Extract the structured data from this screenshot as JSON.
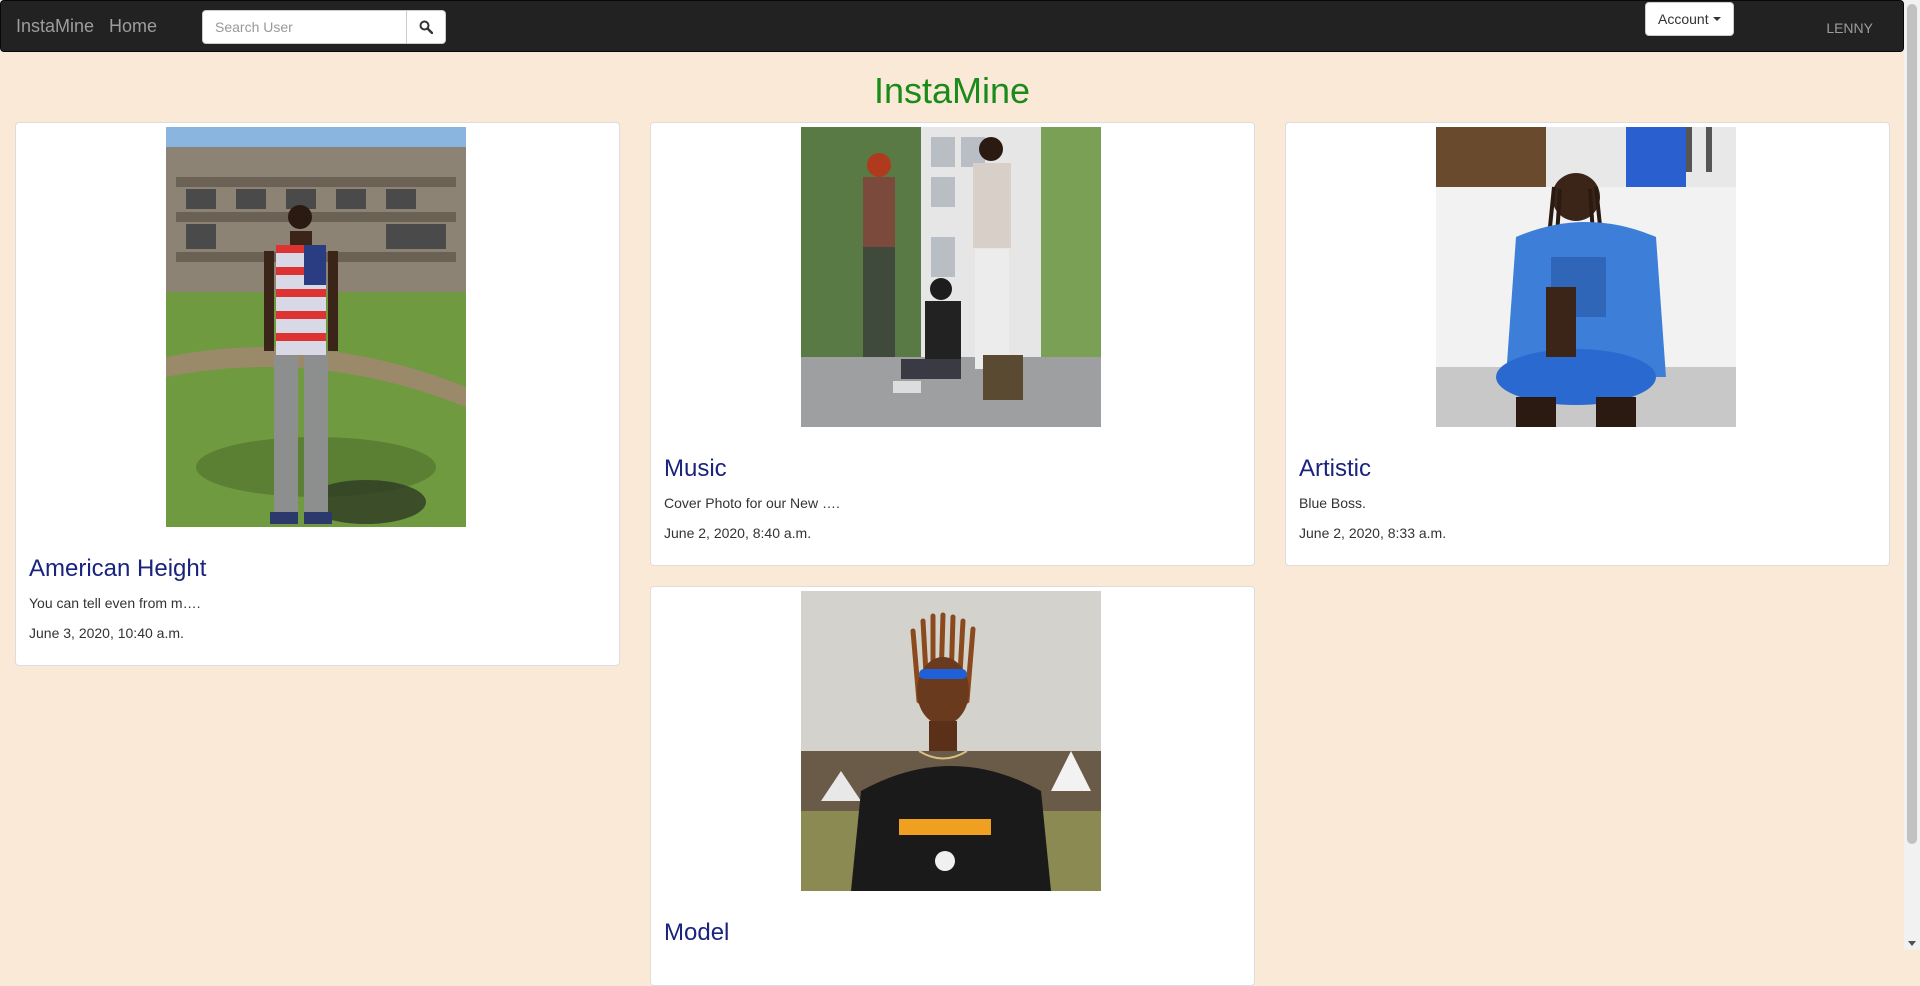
{
  "navbar": {
    "brand": "InstaMine",
    "home_label": "Home",
    "search_placeholder": "Search User",
    "search_icon": "search-icon",
    "account_label": "Account",
    "username": "LENNY"
  },
  "page": {
    "title": "InstaMine"
  },
  "posts": [
    {
      "title": "American Height",
      "caption": "You can tell even from m….",
      "date": "June 3, 2020, 10:40 a.m."
    },
    {
      "title": "Music",
      "caption": "Cover Photo for our New ….",
      "date": "June 2, 2020, 8:40 a.m."
    },
    {
      "title": "Artistic",
      "caption": "Blue Boss.",
      "date": "June 2, 2020, 8:33 a.m."
    },
    {
      "title": "Model"
    }
  ],
  "colors": {
    "navbar_bg": "#222222",
    "page_bg": "#fbe9d7",
    "title_green": "#1a8a1a",
    "card_title": "#1a237e"
  }
}
